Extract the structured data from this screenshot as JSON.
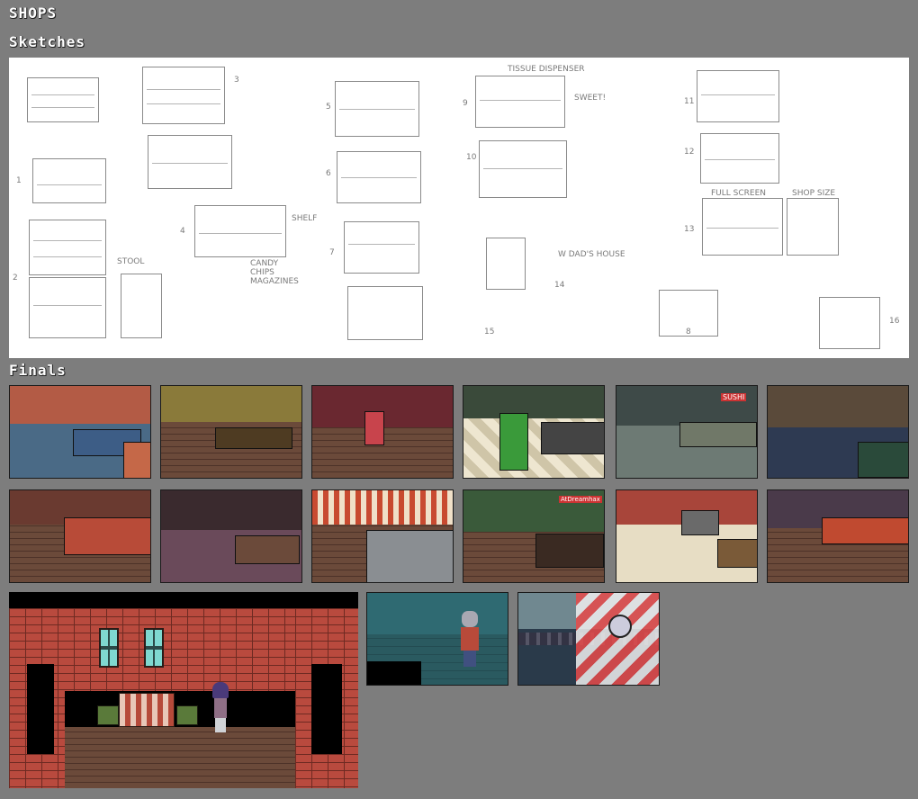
{
  "page": {
    "title": "SHOPS",
    "sketches_heading": "Sketches",
    "finals_heading": "Finals"
  },
  "sketch_notes": {
    "n1": "1",
    "n2": "2",
    "n3": "3",
    "n4": "4",
    "n5": "5",
    "n6": "6",
    "n7": "7",
    "n8": "8",
    "n9": "9",
    "n10": "10",
    "n11": "11",
    "n12": "12",
    "n13": "13",
    "n14": "14",
    "n15": "15",
    "n16": "16",
    "stool": "STOOL",
    "shelf": "SHELF",
    "candy_magazines": "CANDY\nCHIPS\nMAGAZINES",
    "tissue_dispenser": "TISSUE DISPENSER",
    "sweet": "SWEET!",
    "w_dads_house": "W DAD'S HOUSE",
    "full_screen": "FULL SCREEN",
    "shop_size": "SHOP SIZE"
  },
  "finals": {
    "sign_sushi": "SUSHI",
    "sign_tokens": "AtDreamhax"
  },
  "colors": {
    "background": "#7d7d7d",
    "heading": "#ffffff"
  }
}
